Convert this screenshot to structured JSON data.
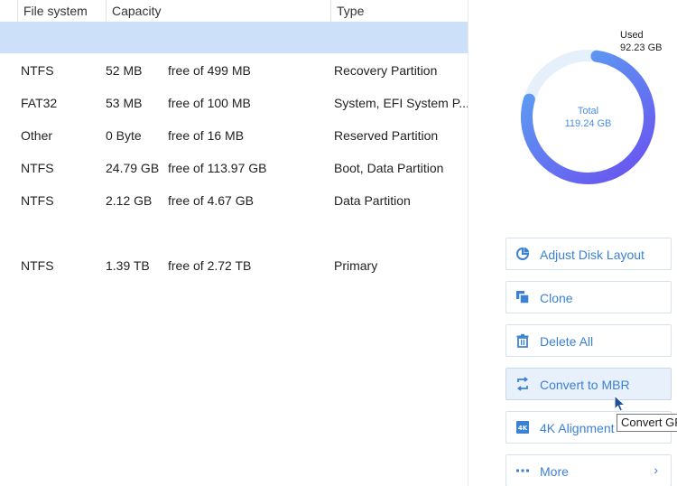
{
  "table": {
    "headers": [
      "File system",
      "Capacity",
      "Type"
    ],
    "rows": [
      {
        "fs": "NTFS",
        "used": "52 MB",
        "free": "free of 499 MB",
        "type": "Recovery Partition"
      },
      {
        "fs": "FAT32",
        "used": "53 MB",
        "free": "free of 100 MB",
        "type": "System, EFI System P..."
      },
      {
        "fs": "Other",
        "used": "0 Byte",
        "free": "free of 16 MB",
        "type": "Reserved Partition"
      },
      {
        "fs": "NTFS",
        "used": "24.79 GB",
        "free": "free of 113.97 GB",
        "type": "Boot, Data Partition"
      },
      {
        "fs": "NTFS",
        "used": "2.12 GB",
        "free": "free of 4.67 GB",
        "type": "Data Partition"
      },
      {
        "fs": "NTFS",
        "used": "1.39 TB",
        "free": "free of 2.72 TB",
        "type": "Primary"
      }
    ]
  },
  "disk": {
    "used_label": "Used",
    "used_value": "92.23 GB",
    "total_label": "Total",
    "total_value": "119.24 GB",
    "used_fraction": 0.7735,
    "colors": {
      "track": "#e6f0fb",
      "start": "#6a4ff0",
      "end": "#5aaaf2"
    }
  },
  "actions": [
    {
      "label": "Adjust Disk Layout",
      "icon": "pie-chart-icon"
    },
    {
      "label": "Clone",
      "icon": "clone-icon"
    },
    {
      "label": "Delete All",
      "icon": "trash-icon"
    },
    {
      "label": "Convert to MBR",
      "icon": "convert-icon"
    },
    {
      "label": "4K Alignment",
      "icon": "4k-icon"
    },
    {
      "label": "More",
      "icon": "more-dots-icon"
    }
  ],
  "tooltip": "Convert GPT to MBR",
  "accent": "#3b82d6"
}
